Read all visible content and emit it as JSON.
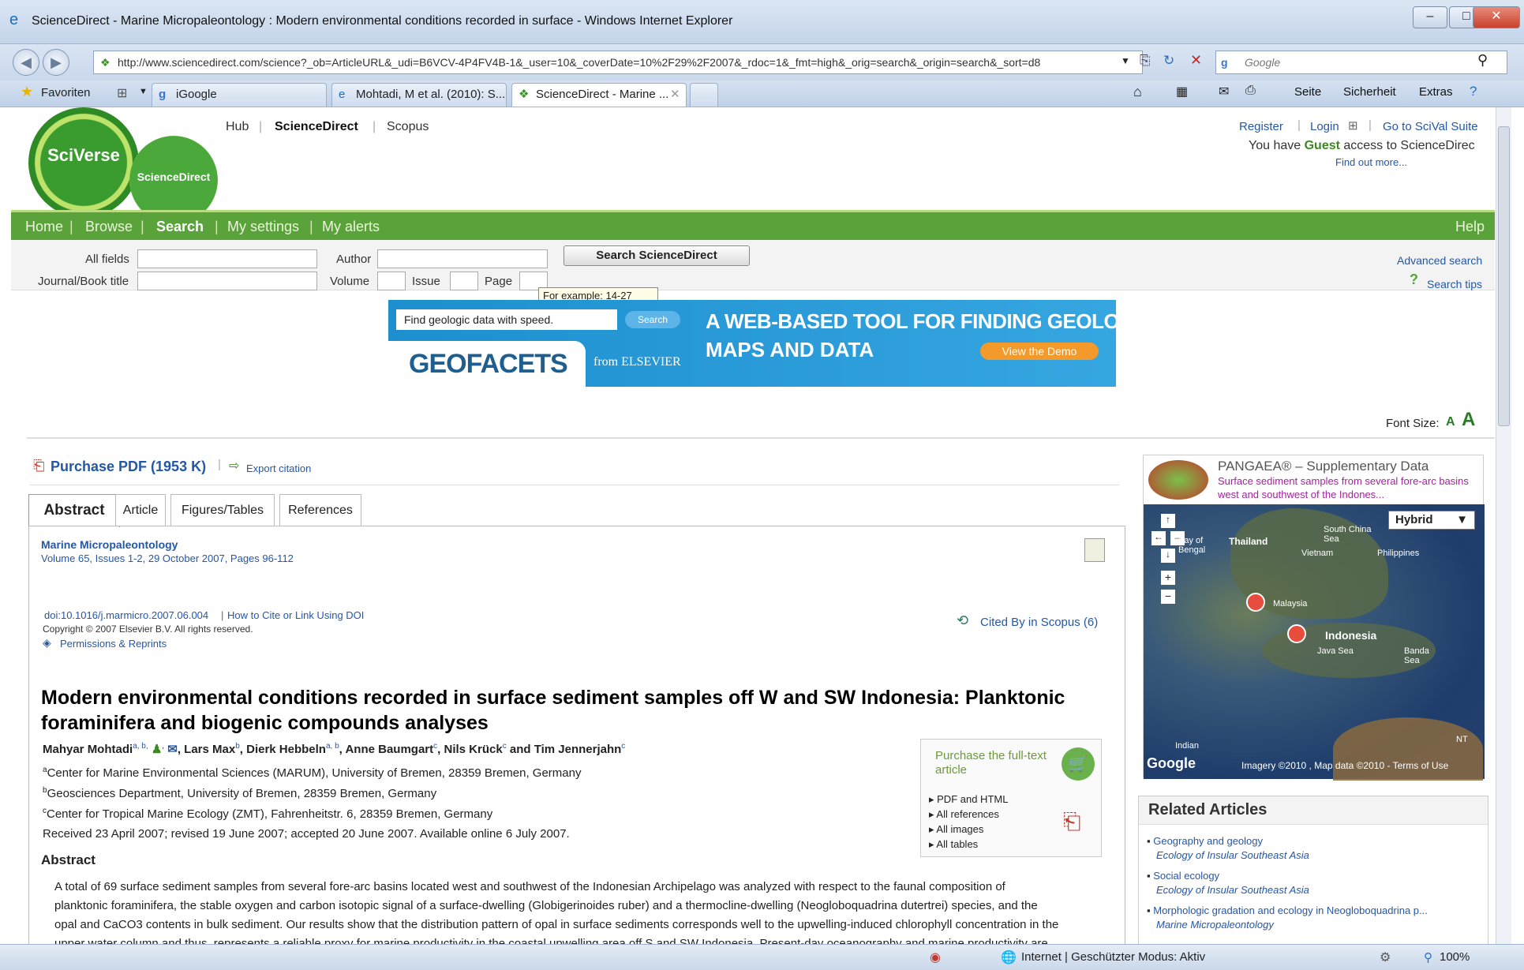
{
  "window": {
    "title": "ScienceDirect - Marine Micropaleontology : Modern environmental conditions recorded in surface  - Windows Internet Explorer",
    "controls": {
      "minimize": "–",
      "maximize": "□",
      "close": "✕"
    }
  },
  "addressbar": {
    "url": "http://www.sciencedirect.com/science?_ob=ArticleURL&_udi=B6VCV-4P4FV4B-1&_user=10&_coverDate=10%2F29%2F2007&_rdoc=1&_fmt=high&_orig=search&_origin=search&_sort=d8",
    "search_placeholder": "Google"
  },
  "tabs": {
    "favorites": "Favoriten",
    "items": [
      {
        "label": "iGoogle"
      },
      {
        "label": "Mohtadi, M et al. (2010): S..."
      },
      {
        "label": "ScienceDirect - Marine ..."
      }
    ]
  },
  "commandbar": {
    "page": "Seite",
    "security": "Sicherheit",
    "extras": "Extras"
  },
  "site": {
    "logo_main": "SciVerse",
    "logo_sub": "ScienceDirect",
    "top_links": [
      "Hub",
      "ScienceDirect",
      "Scopus"
    ],
    "register": "Register",
    "login": "Login",
    "scival": "Go to SciVal Suite",
    "guest_pre": "You have ",
    "guest_bold": "Guest",
    "guest_post": " access to ScienceDirec",
    "find_out": "Find out more...",
    "nav": {
      "home": "Home",
      "browse": "Browse",
      "search": "Search",
      "settings": "My settings",
      "alerts": "My alerts",
      "help": "Help"
    }
  },
  "searchform": {
    "all_fields": "All fields",
    "author": "Author",
    "journal": "Journal/Book title",
    "volume": "Volume",
    "issue": "Issue",
    "page": "Page",
    "button": "Search ScienceDirect",
    "tooltip": "For example: 14-27",
    "advanced": "Advanced search",
    "tips": "Search tips"
  },
  "banner": {
    "input": "Find geologic data with speed.",
    "search": "Search",
    "line1": "A WEB-BASED TOOL FOR FINDING GEOLOGIC",
    "line2": "MAPS AND DATA",
    "demo": "View the Demo",
    "brand": "GEOFACETS",
    "from": "from ELSEVIER"
  },
  "fontsize": "Font Size:",
  "article": {
    "purchase_pdf": "Purchase PDF (1953 K)",
    "export": "Export citation",
    "tabs": [
      "Abstract",
      "Article",
      "Figures/Tables",
      "References"
    ],
    "journal": "Marine Micropaleontology",
    "volume": "Volume 65, Issues 1-2, 29 October 2007, Pages 96-112",
    "doi": "doi:10.1016/j.marmicro.2007.06.004",
    "cite": "How to Cite or Link Using DOI",
    "copyright": "Copyright © 2007 Elsevier B.V. All rights reserved.",
    "permissions": "Permissions & Reprints",
    "cited_by": "Cited By in Scopus (6)",
    "title": "Modern environmental conditions recorded in surface sediment samples off W and SW Indonesia: Planktonic foraminifera and biogenic compounds analyses",
    "authors": [
      {
        "name": "Mahyar Mohtadi",
        "sup": "a, b,"
      },
      {
        "name": "Lars Max",
        "sup": "b"
      },
      {
        "name": "Dierk Hebbeln",
        "sup": "a, b"
      },
      {
        "name": "Anne Baumgart",
        "sup": "c"
      },
      {
        "name": "Nils Krück",
        "sup": "c"
      },
      {
        "name": "Tim Jennerjahn",
        "sup": "c"
      }
    ],
    "and": "and",
    "affiliations": [
      {
        "sup": "a",
        "text": "Center for Marine Environmental Sciences (MARUM), University of Bremen, 28359 Bremen, Germany"
      },
      {
        "sup": "b",
        "text": "Geosciences Department, University of Bremen, 28359 Bremen, Germany"
      },
      {
        "sup": "c",
        "text": "Center for Tropical Marine Ecology (ZMT), Fahrenheitstr. 6, 28359 Bremen, Germany"
      }
    ],
    "received": "Received 23 April 2007;  revised 19 June 2007;  accepted 20 June 2007.  Available online 6 July 2007.",
    "abstract_heading": "Abstract",
    "abstract_l1": "A total of 69 surface sediment samples from several fore-arc basins located west and southwest of the Indonesian Archipelago was analyzed with respect to the faunal composition of",
    "abstract_l2": "planktonic foraminifera, the stable oxygen and carbon isotopic signal of a surface-dwelling (Globigerinoides ruber) and a thermocline-dwelling (Neogloboquadrina dutertrei) species, and the",
    "abstract_l3": "opal and CaCO3 contents in bulk sediment. Our results show that the distribution pattern of opal in surface sediments corresponds well to the upwelling-induced chlorophyll concentration in the",
    "abstract_l4": "upper water column and thus, represents a reliable proxy for marine productivity in the coastal upwelling area off S and SW Indonesia. Present-day oceanography and marine productivity are"
  },
  "purchase_box": {
    "title": "Purchase the full-text article",
    "items": [
      "PDF and HTML",
      "All references",
      "All images",
      "All tables"
    ]
  },
  "pangaea": {
    "title": "PANGAEA® – Supplementary Data",
    "desc": "Surface sediment samples from several fore-arc basins west and southwest of the Indones...",
    "map_type": "Hybrid",
    "labels": [
      "Thailand",
      "South China Sea",
      "Vietnam",
      "Philippines",
      "Malaysia",
      "Indonesia",
      "Java Sea",
      "Banda Sea",
      "Bay of Bengal",
      "Indian",
      "NT"
    ],
    "attribution": "Imagery ©2010 , Map data ©2010 - Terms of Use"
  },
  "related": {
    "title": "Related Articles",
    "items": [
      {
        "title": "Geography and geology",
        "journal": "Ecology of Insular Southeast Asia"
      },
      {
        "title": "Social ecology",
        "journal": "Ecology of Insular Southeast Asia"
      },
      {
        "title": "Morphologic gradation and ecology in Neogloboquadrina p...",
        "journal": "Marine Micropaleontology"
      }
    ]
  },
  "status": {
    "zone": "Internet | Geschützter Modus: Aktiv",
    "zoom": "100%"
  }
}
